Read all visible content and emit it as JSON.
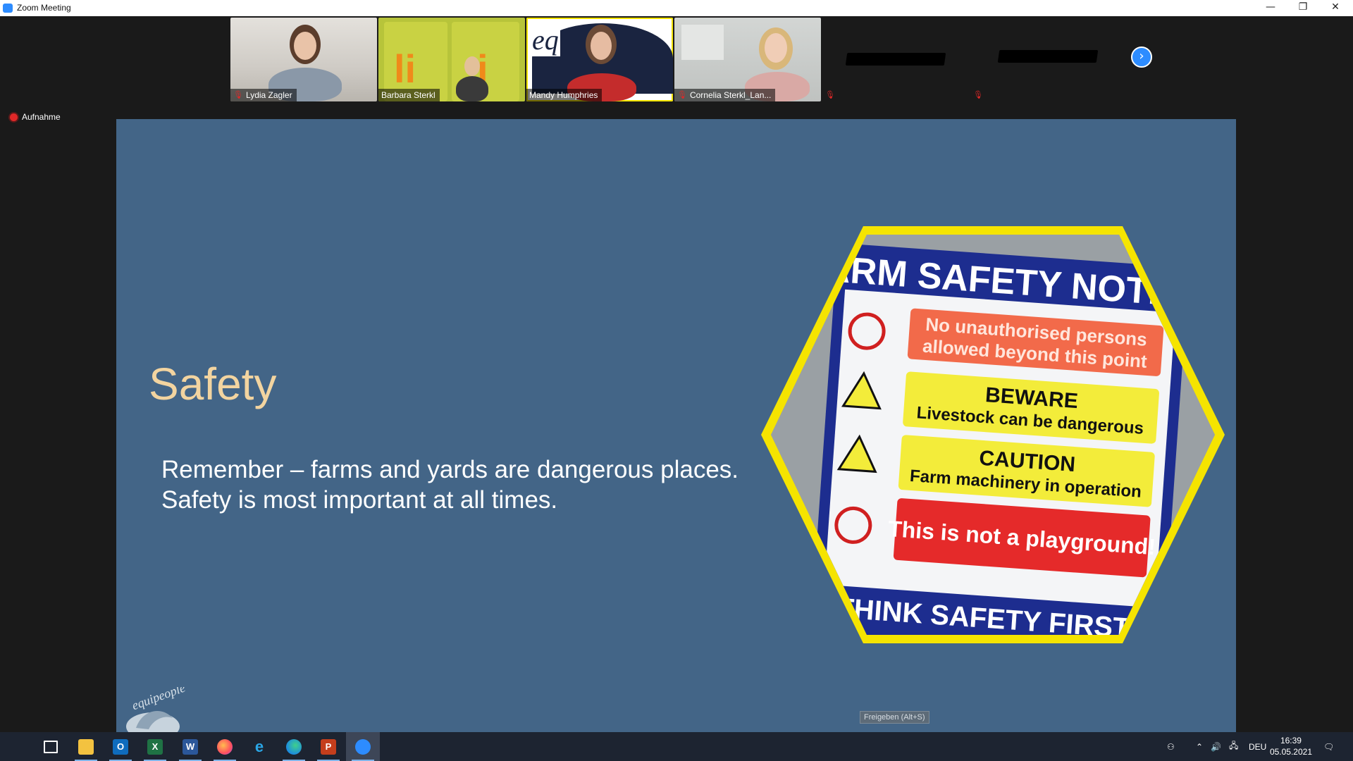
{
  "window": {
    "title": "Zoom Meeting",
    "controls": {
      "minimize": "—",
      "restore": "❐",
      "close": "✕"
    }
  },
  "participants": [
    {
      "name": "Lydia Zagler",
      "muted": true
    },
    {
      "name": "Barbara Sterkl",
      "muted": false
    },
    {
      "name": "Mandy Humphries",
      "muted": false,
      "active_speaker": true
    },
    {
      "name": "Cornelia Sterkl_Lan...",
      "muted": true
    },
    {
      "name": "",
      "muted": true,
      "video_off": true
    },
    {
      "name": "",
      "muted": true,
      "video_off": true
    }
  ],
  "recording": {
    "label": "Aufnahme"
  },
  "slide": {
    "title": "Safety",
    "body_line1": "Remember – farms and yards are dangerous places.",
    "body_line2": "Safety is most important at all times.",
    "sign": {
      "header": "ARM SAFETY NOTIC",
      "row1": "No unauthorised persons allowed beyond this point",
      "row2_title": "BEWARE",
      "row2_text": "Livestock can be dangerous",
      "row3_title": "CAUTION",
      "row3_text": "Farm machinery in operation",
      "row4": "This is not a playground!",
      "footer": "THINK SAFETY FIRST!"
    },
    "logo_text": "equipeople"
  },
  "share_tooltip": "Freigeben (Alt+S)",
  "taskbar": {
    "apps": [
      "start",
      "task-view",
      "file-explorer",
      "outlook",
      "excel",
      "word",
      "firefox",
      "internet-explorer",
      "edge",
      "powerpoint",
      "zoom"
    ],
    "language": "DEU",
    "time": "16:39",
    "date": "05.05.2021"
  },
  "colors": {
    "slide_bg": "#436587",
    "title_color": "#f2d4a0",
    "sign_border": "#f5e400",
    "zoom_blue": "#2d8cff"
  }
}
